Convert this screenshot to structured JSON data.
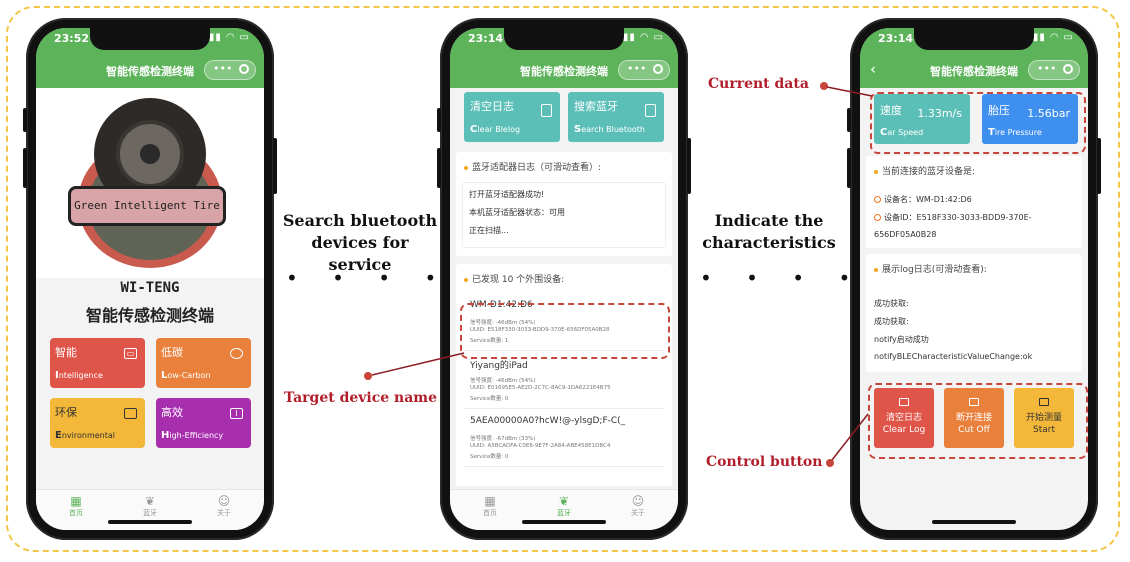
{
  "colors": {
    "green": "#5cb35a",
    "teal": "#5bbfb7",
    "blue": "#3f8fef",
    "red": "#e0554a",
    "orange": "#e9803c",
    "yellow": "#f3b839",
    "purple": "#a72fae",
    "annot_red": "#b01e2a",
    "frame": "#f3c64a"
  },
  "annotations": {
    "search_line1": "Search bluetooth",
    "search_line2": "devices for service",
    "indicate_line1": "Indicate the",
    "indicate_line2": "characteristics",
    "current_data": "Current data",
    "target_device": "Target device name",
    "control_button": "Control button",
    "dots": "• • • •"
  },
  "phone1": {
    "time": "23:52",
    "title": "智能传感检测终端",
    "banner": "Green Intelligent Tire",
    "brand_en": "WI-TENG",
    "brand_zh": "智能传感检测终端",
    "tiles": [
      {
        "zh": "智能",
        "en_first": "I",
        "en_rest": "ntelligence",
        "icon": "card-icon"
      },
      {
        "zh": "低碳",
        "en_first": "L",
        "en_rest": "ow-Carbon",
        "icon": "palette-icon"
      },
      {
        "zh": "环保",
        "en_first": "E",
        "en_rest": "nvironmental",
        "icon": "calendar-icon"
      },
      {
        "zh": "高效",
        "en_first": "H",
        "en_rest": "igh-Efficiency",
        "icon": "info-icon"
      }
    ],
    "tabs": [
      "首页",
      "蓝牙",
      "关于"
    ]
  },
  "phone2": {
    "time": "23:14",
    "title": "智能传感检测终端",
    "btn_clear": {
      "zh": "清空日志",
      "en_first": "C",
      "en_rest": "lear Blelog"
    },
    "btn_search": {
      "zh": "搜索蓝牙",
      "en_first": "S",
      "en_rest": "earch Bluetooth"
    },
    "log_head": "蓝牙适配器日志（可滑动查看）:",
    "log_lines": [
      "打开蓝牙适配器成功!",
      "本机蓝牙适配器状态：可用",
      "正在扫描..."
    ],
    "found_head": "已发现 10 个外围设备:",
    "devices": [
      {
        "name": "WM-D1:42:D6",
        "signal": "信号强度: -46dBm (54%)",
        "uuid": "UUID: E518F330-3033-BDD9-370E-656DF05A0B28",
        "service": "Service数量: 1"
      },
      {
        "name": "Yiyang的iPad",
        "signal": "信号强度: -46dBm (54%)",
        "uuid": "UUID: E01695E5-AE2D-2C7C-8AC9-1DA6221E4B75",
        "service": "Service数量: 0"
      },
      {
        "name": "5AEA00000A0?hcW!@-ylsgD;F-C(_",
        "signal": "信号强度: -67dBm (33%)",
        "uuid": "UUID: A5BCADFA-C0E6-9E7F-2A84-ABE458E1DBC4",
        "service": "Service数量: 0"
      }
    ],
    "tabs": [
      "首页",
      "蓝牙",
      "关于"
    ]
  },
  "phone3": {
    "time": "23:14",
    "title": "智能传感检测终端",
    "speed": {
      "zh": "速度",
      "value": "1.33m/s",
      "en_first": "C",
      "en_rest": "ar Speed"
    },
    "pressure": {
      "zh": "胎压",
      "value": "1.56bar",
      "en_first": "T",
      "en_rest": "ire Pressure"
    },
    "conn_head": "当前连接的蓝牙设备是:",
    "device_name": "设备名：WM-D1:42:D6",
    "device_id_1": "设备ID：E518F330-3033-BDD9-370E-",
    "device_id_2": "656DF05A0B28",
    "log_head": "展示log日志(可滑动查看):",
    "log_lines": [
      "成功获取:",
      "成功获取:",
      "notify启动成功",
      "notifyBLECharacteristicValueChange:ok"
    ],
    "controls": [
      {
        "zh": "清空日志",
        "en": "Clear Log"
      },
      {
        "zh": "断开连接",
        "en": "Cut Off"
      },
      {
        "zh": "开始测量",
        "en": "Start"
      }
    ]
  }
}
